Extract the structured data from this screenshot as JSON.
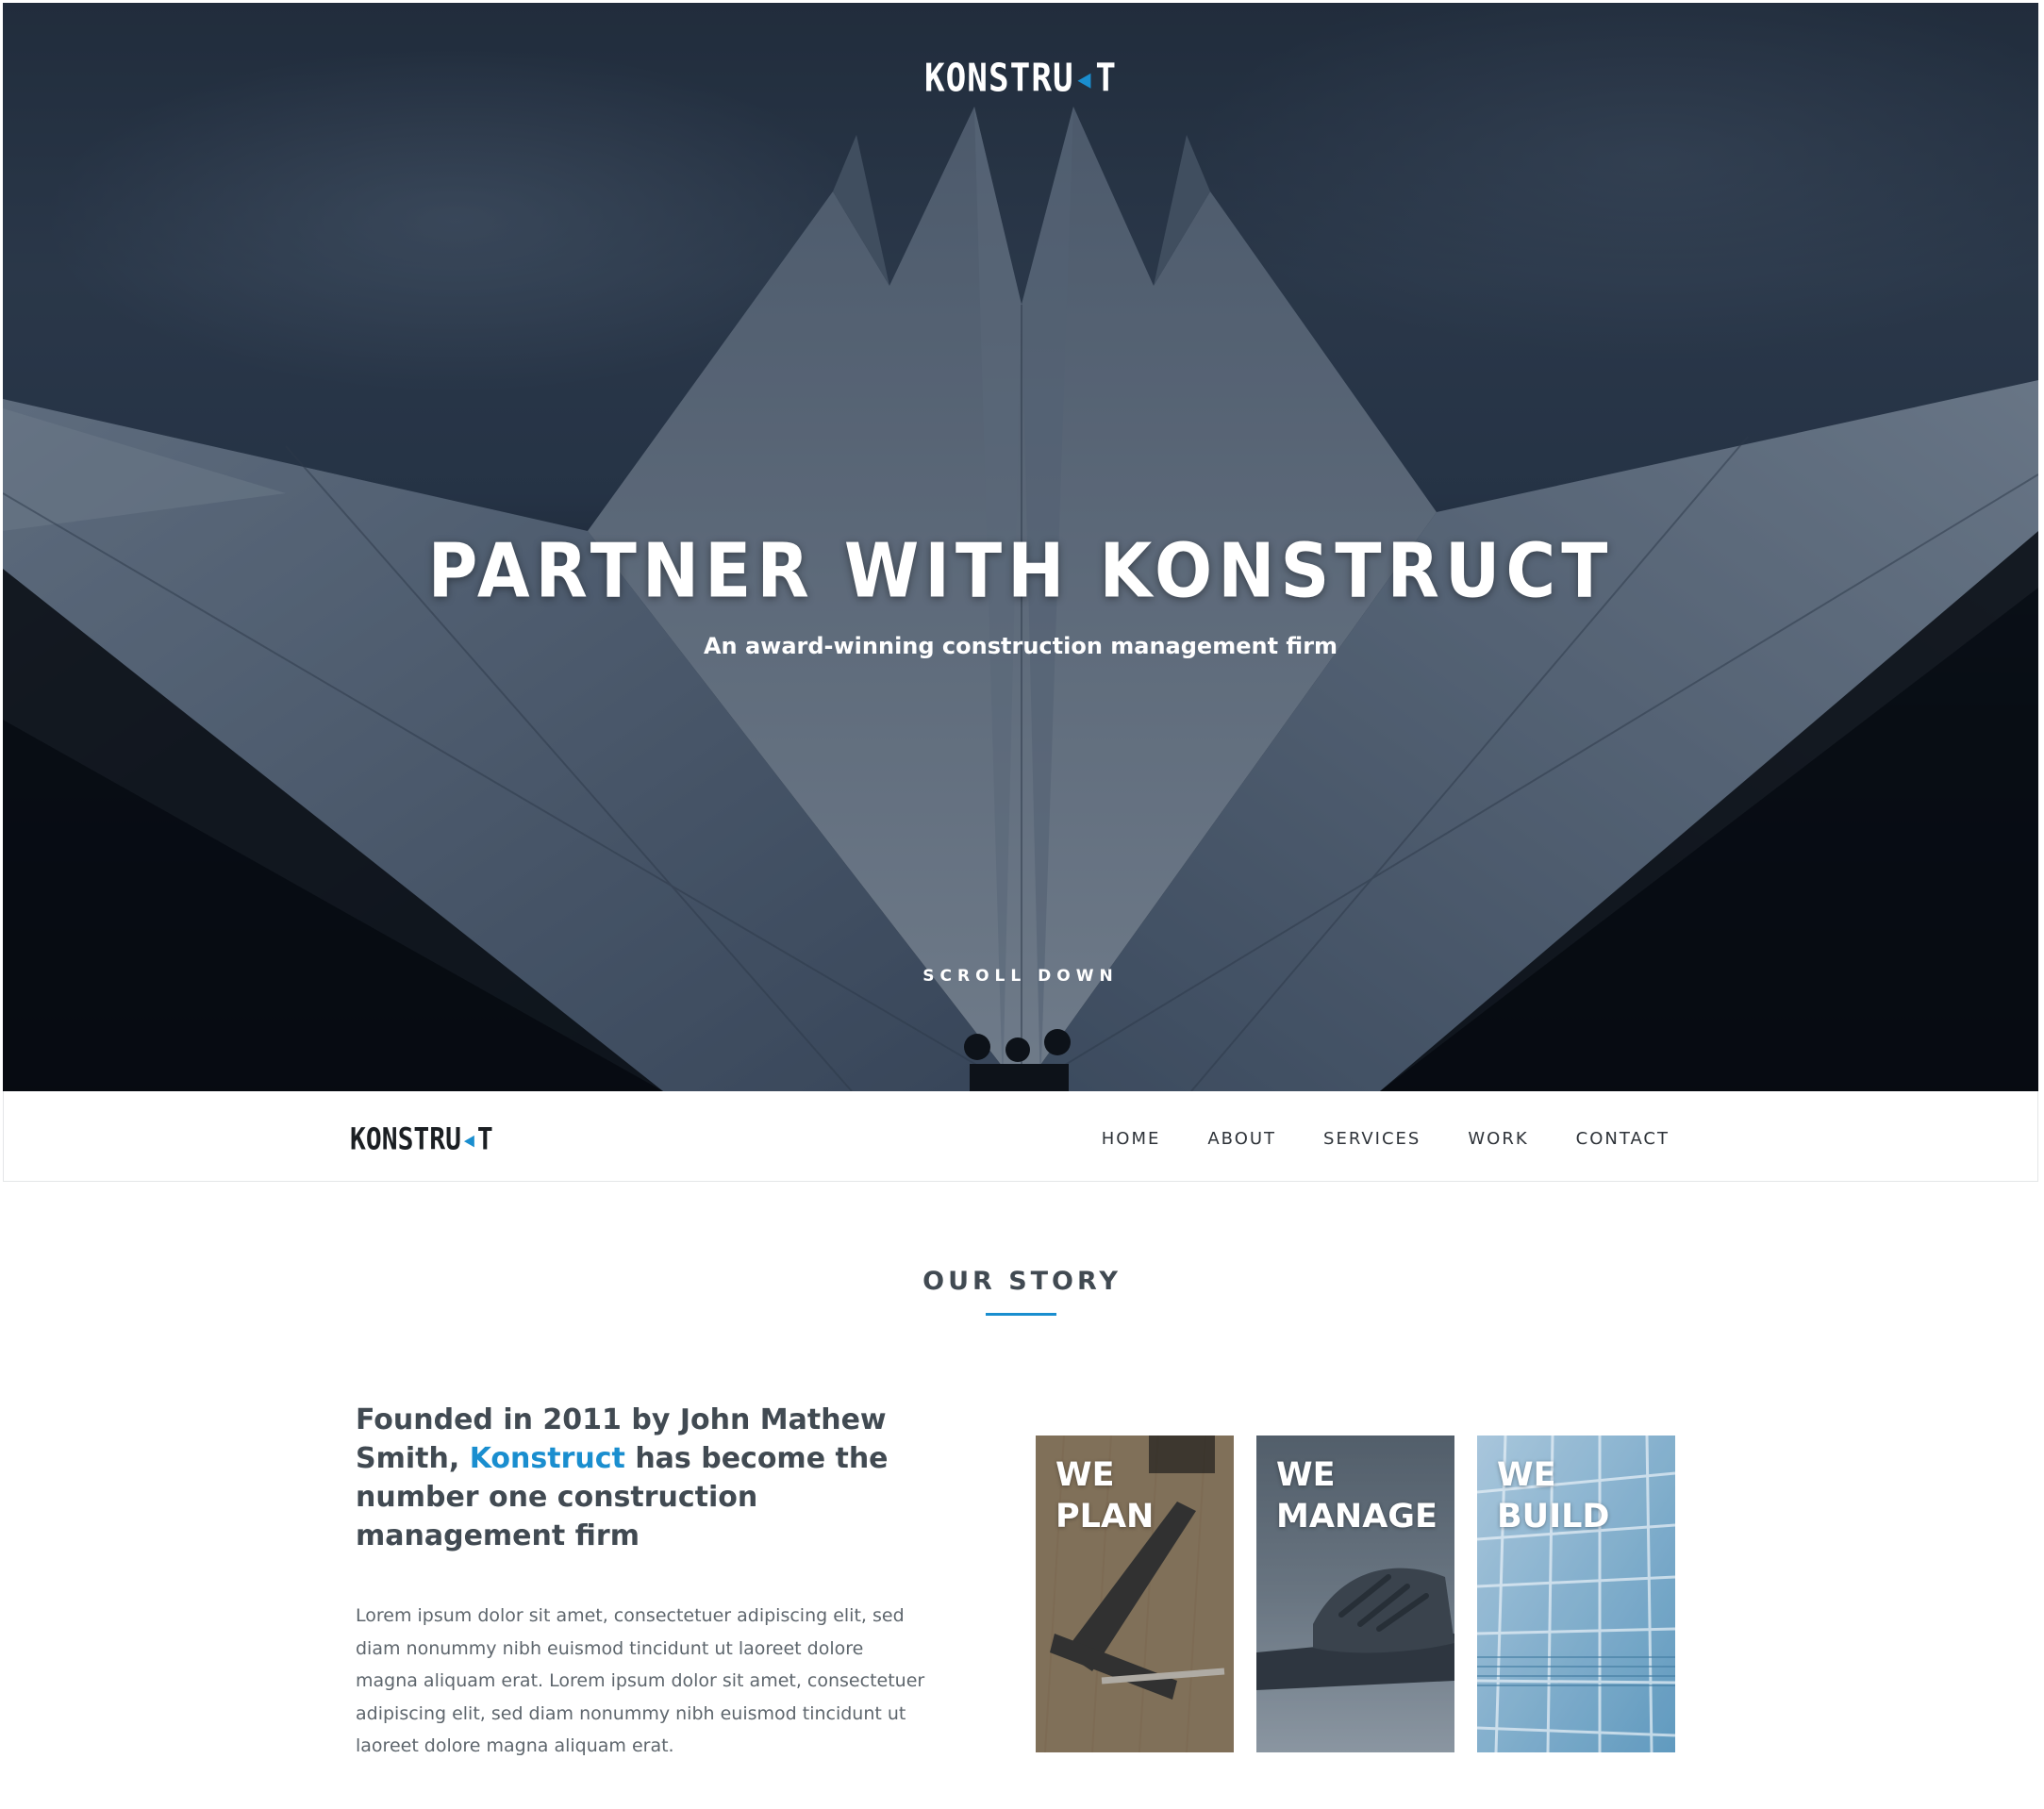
{
  "brand": {
    "logo_main": "KONSTRU",
    "logo_accent": "◂",
    "logo_end": "T"
  },
  "hero": {
    "title": "PARTNER WITH KONSTRUCT",
    "subtitle": "An award-winning construction management firm",
    "scroll_label": "SCROLL DOWN"
  },
  "nav": {
    "items": [
      {
        "label": "HOME"
      },
      {
        "label": "ABOUT"
      },
      {
        "label": "SERVICES"
      },
      {
        "label": "WORK"
      },
      {
        "label": "CONTACT"
      }
    ]
  },
  "story": {
    "heading": "OUR STORY",
    "lead_before": "Founded in 2011 by John Mathew Smith, ",
    "lead_accent": "Konstruct",
    "lead_after": " has become the number one construction management firm",
    "body": "Lorem ipsum dolor sit amet, consectetuer adipiscing elit, sed diam nonummy nibh euismod tincidunt ut laoreet dolore magna aliquam erat. Lorem ipsum dolor sit amet, consectetuer adipiscing elit, sed diam nonummy nibh euismod tincidunt ut laoreet dolore magna aliquam erat."
  },
  "cards": [
    {
      "line1": "WE",
      "line2": "PLAN"
    },
    {
      "line1": "WE",
      "line2": "MANAGE"
    },
    {
      "line1": "WE",
      "line2": "BUILD"
    }
  ],
  "colors": {
    "accent": "#1a8ecf",
    "text": "#414a52",
    "body_text": "#5e666d"
  },
  "icons": {
    "logo_mark": "chevron-left-icon"
  }
}
